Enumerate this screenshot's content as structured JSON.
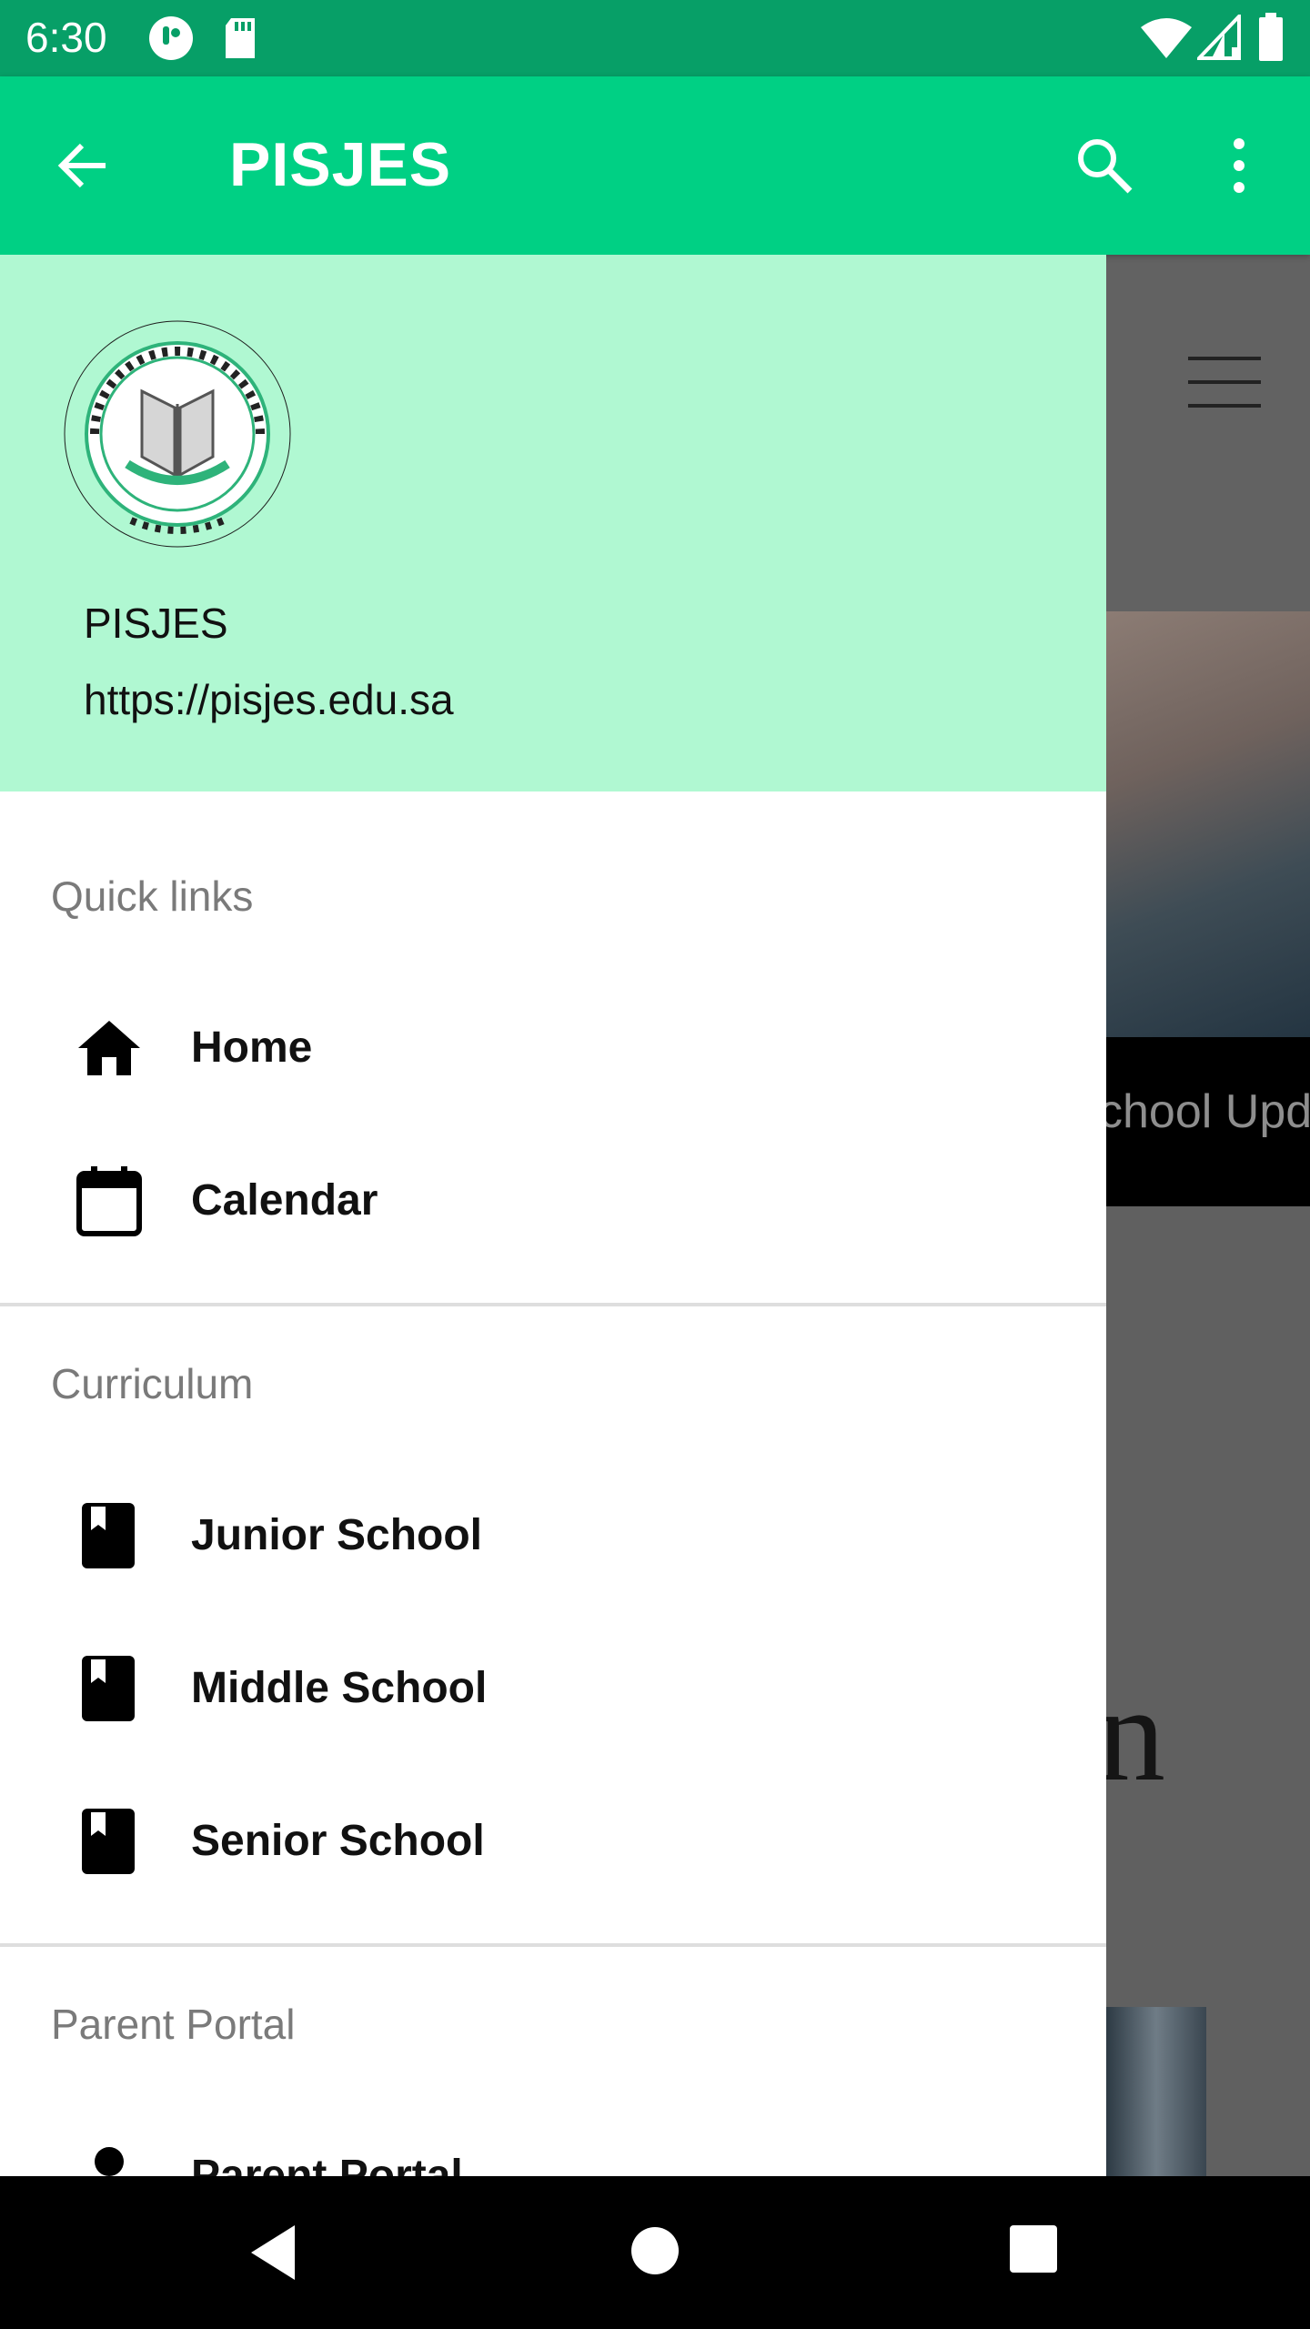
{
  "status_bar": {
    "time": "6:30"
  },
  "app_bar": {
    "title": "PISJES"
  },
  "background": {
    "band_text": "chool Upd",
    "partial_letter": "n"
  },
  "drawer": {
    "logo_alt": "PAKISTAN INTERNATIONAL SCHOOL JEDDAH ENGLISH SECTION",
    "name": "PISJES",
    "url": "https://pisjes.edu.sa",
    "sections": [
      {
        "title": "Quick links",
        "items": [
          {
            "label": "Home",
            "icon": "home-icon"
          },
          {
            "label": "Calendar",
            "icon": "calendar-icon"
          }
        ]
      },
      {
        "title": "Curriculum",
        "items": [
          {
            "label": "Junior School",
            "icon": "book-icon"
          },
          {
            "label": "Middle School",
            "icon": "book-icon"
          },
          {
            "label": "Senior School",
            "icon": "book-icon"
          }
        ]
      },
      {
        "title": "Parent Portal",
        "items": [
          {
            "label": "Parent Portal",
            "icon": "person-icon"
          }
        ]
      }
    ]
  },
  "colors": {
    "status_bar": "#079f67",
    "app_bar": "#00d084",
    "drawer_header": "#b0f8d2"
  }
}
